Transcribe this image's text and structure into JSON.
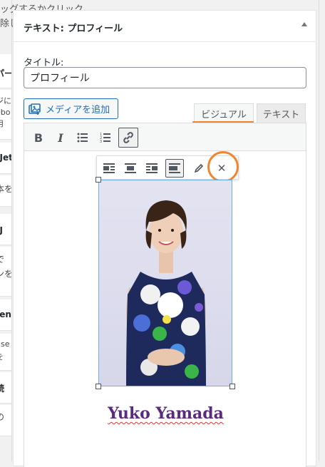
{
  "background_hint": {
    "line1": "ッグするかクリック",
    "line2": "除し"
  },
  "left_panels": [
    {
      "text": "パー",
      "bold": true
    },
    {
      "text": "ジに\nebo\n用"
    },
    {
      "text": "(Jet",
      "bold": true
    },
    {
      "text": "本を"
    },
    {
      "text": "(J",
      "bold": true
    },
    {
      "text": "で\nンを"
    },
    {
      "text": "fen",
      "bold": true
    },
    {
      "text": "nse\nを"
    },
    {
      "text": "読",
      "bold": true
    },
    {
      "text": "の"
    }
  ],
  "widget": {
    "title_prefix": "テキスト",
    "title_sep": ": ",
    "title_name": "プロフィール",
    "collapse_icon": "arrow-up-icon"
  },
  "form": {
    "title_label": "タイトル:",
    "title_value": "プロフィール",
    "media_button": "メディアを追加"
  },
  "tabs": {
    "visual": "ビジュアル",
    "text": "テキスト",
    "active": "visual",
    "highlight_color": "#f0852d"
  },
  "toolbar": {
    "buttons": [
      "bold-icon",
      "italic-icon",
      "bullet-list-icon",
      "numbered-list-icon",
      "link-icon"
    ],
    "bold_glyph": "B",
    "italic_glyph": "I"
  },
  "image_toolbar": {
    "buttons": [
      "align-left-icon",
      "align-center-icon",
      "align-right-icon",
      "align-none-icon",
      "edit-pencil-icon",
      "remove-x-icon"
    ],
    "remove_glyph": "✕"
  },
  "caption": {
    "name": "Yuko Yamada",
    "color": "#5a2a7e"
  }
}
